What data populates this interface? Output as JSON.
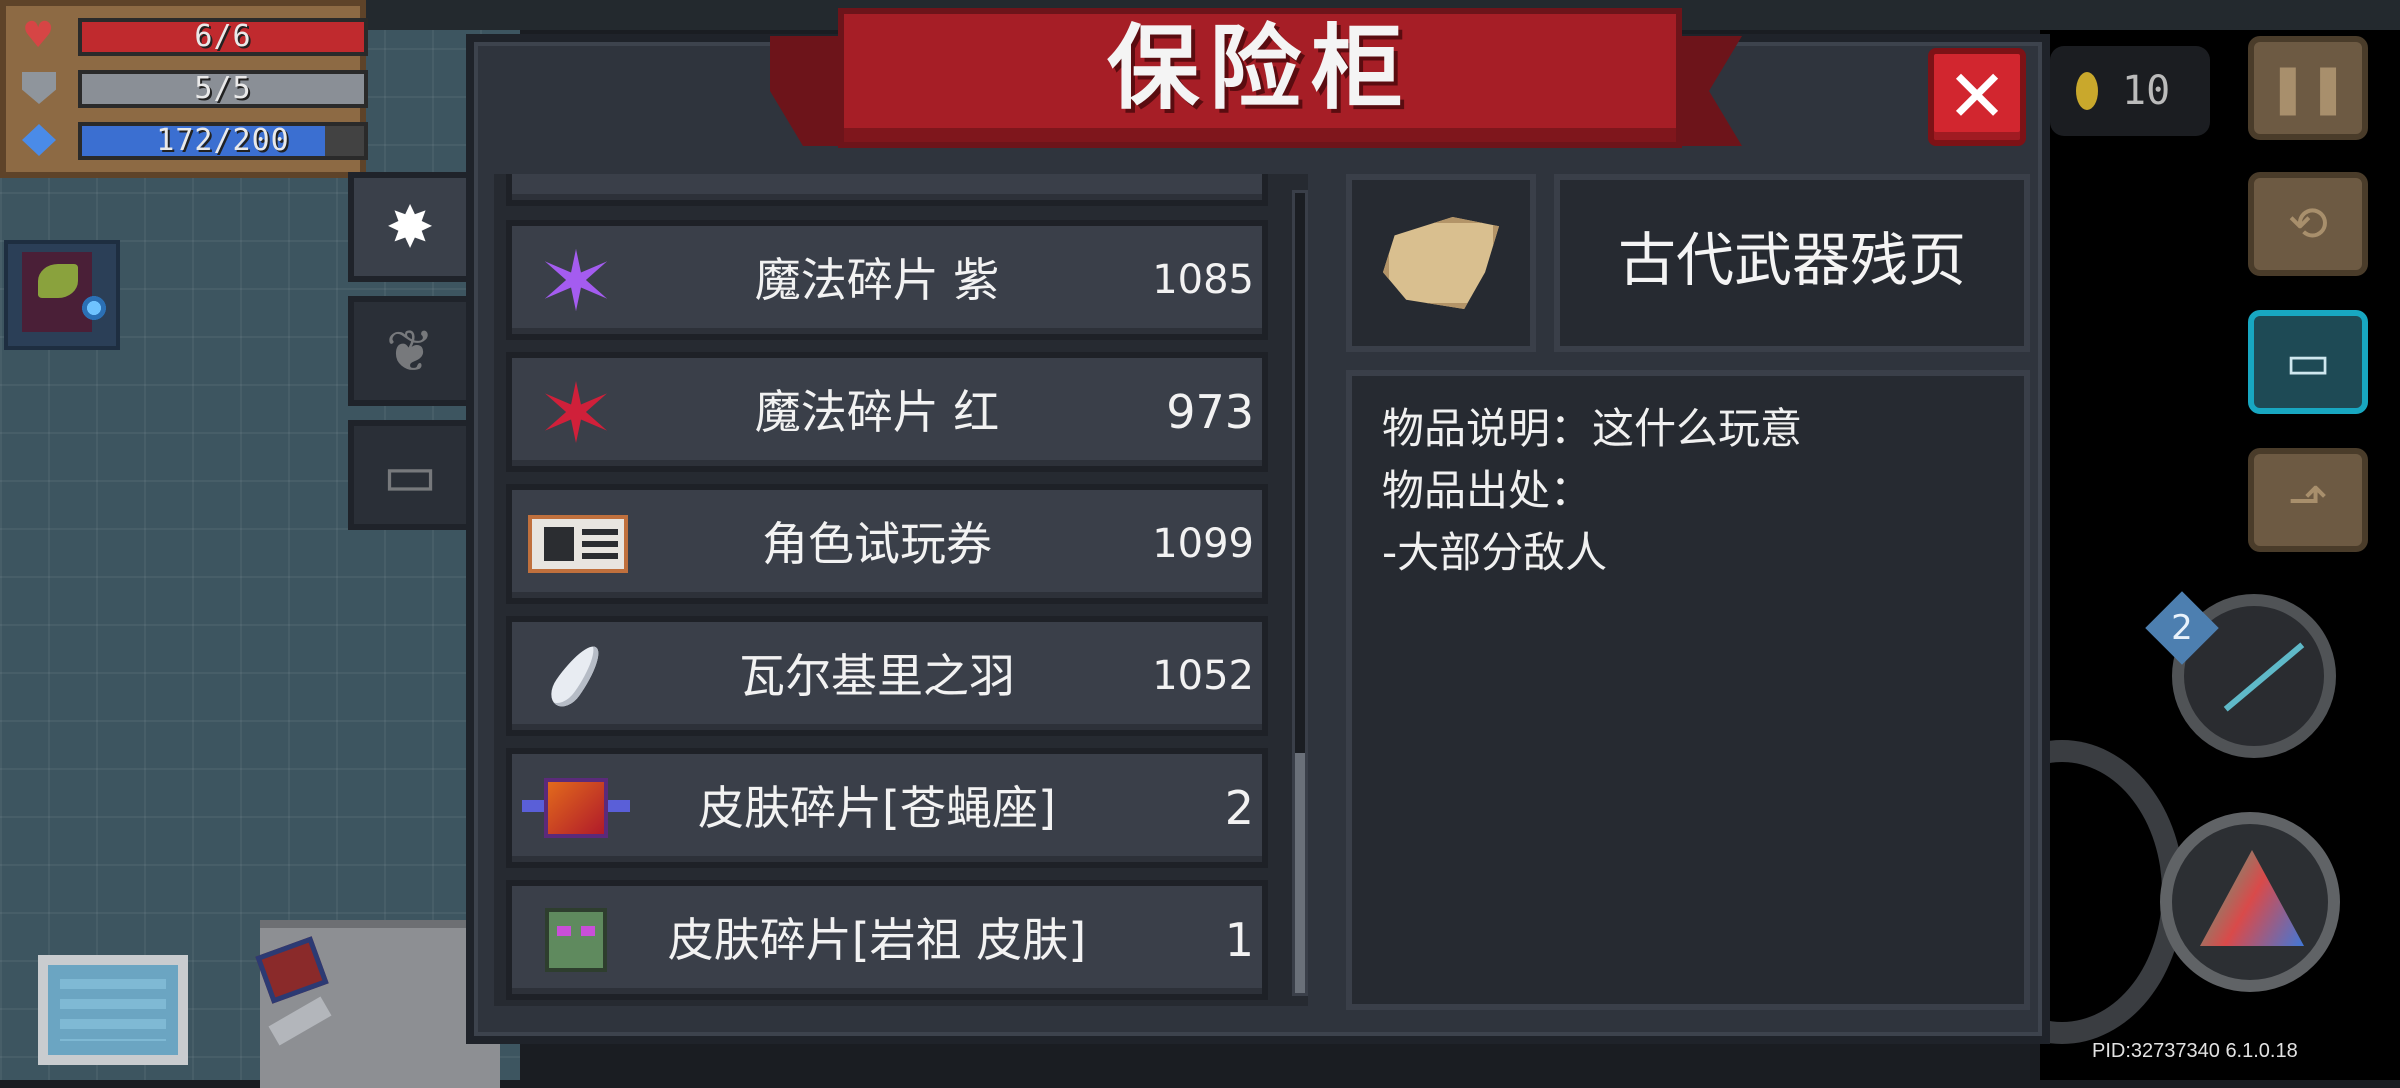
{
  "dialog": {
    "title": "保险柜",
    "close_label": "✕"
  },
  "hud": {
    "health": {
      "label": "6/6",
      "fraction": 1.0,
      "color": "#c02a2e"
    },
    "armor": {
      "label": "5/5",
      "fraction": 1.0,
      "color": "#8a8f96"
    },
    "energy": {
      "label": "172/200",
      "fraction": 0.86,
      "color": "#3b6fd1"
    },
    "coins": "10"
  },
  "tabs": [
    {
      "icon": "spark-icon",
      "active": true
    },
    {
      "icon": "plant-icon",
      "active": false
    },
    {
      "icon": "ticket-icon",
      "active": false
    }
  ],
  "items": [
    {
      "name": "魔法碎片 紫",
      "count": "1085",
      "icon": "purple-shard-icon"
    },
    {
      "name": "魔法碎片 红",
      "count": "973",
      "icon": "red-shard-icon"
    },
    {
      "name": "角色试玩券",
      "count": "1099",
      "icon": "trial-ticket-icon"
    },
    {
      "name": "瓦尔基里之羽",
      "count": "1052",
      "icon": "feather-icon"
    },
    {
      "name": "皮肤碎片[苍蝇座]",
      "count": "2",
      "icon": "skin-fragment-fly-icon"
    },
    {
      "name": "皮肤碎片[岩祖 皮肤]",
      "count": "1",
      "icon": "skin-fragment-rock-icon"
    }
  ],
  "detail": {
    "name": "古代武器残页",
    "icon": "parchment-icon",
    "description_line": "物品说明：这什么玩意",
    "source_label": "物品出处：",
    "source_value": "-大部分敌人"
  },
  "side_buttons": [
    {
      "icon": "pause-icon"
    },
    {
      "icon": "swap-icon"
    },
    {
      "icon": "inventory-icon"
    },
    {
      "icon": "exit-icon"
    }
  ],
  "weapon": {
    "badge": "2"
  },
  "footer": {
    "pid": "PID:32737340 6.1.0.18"
  }
}
